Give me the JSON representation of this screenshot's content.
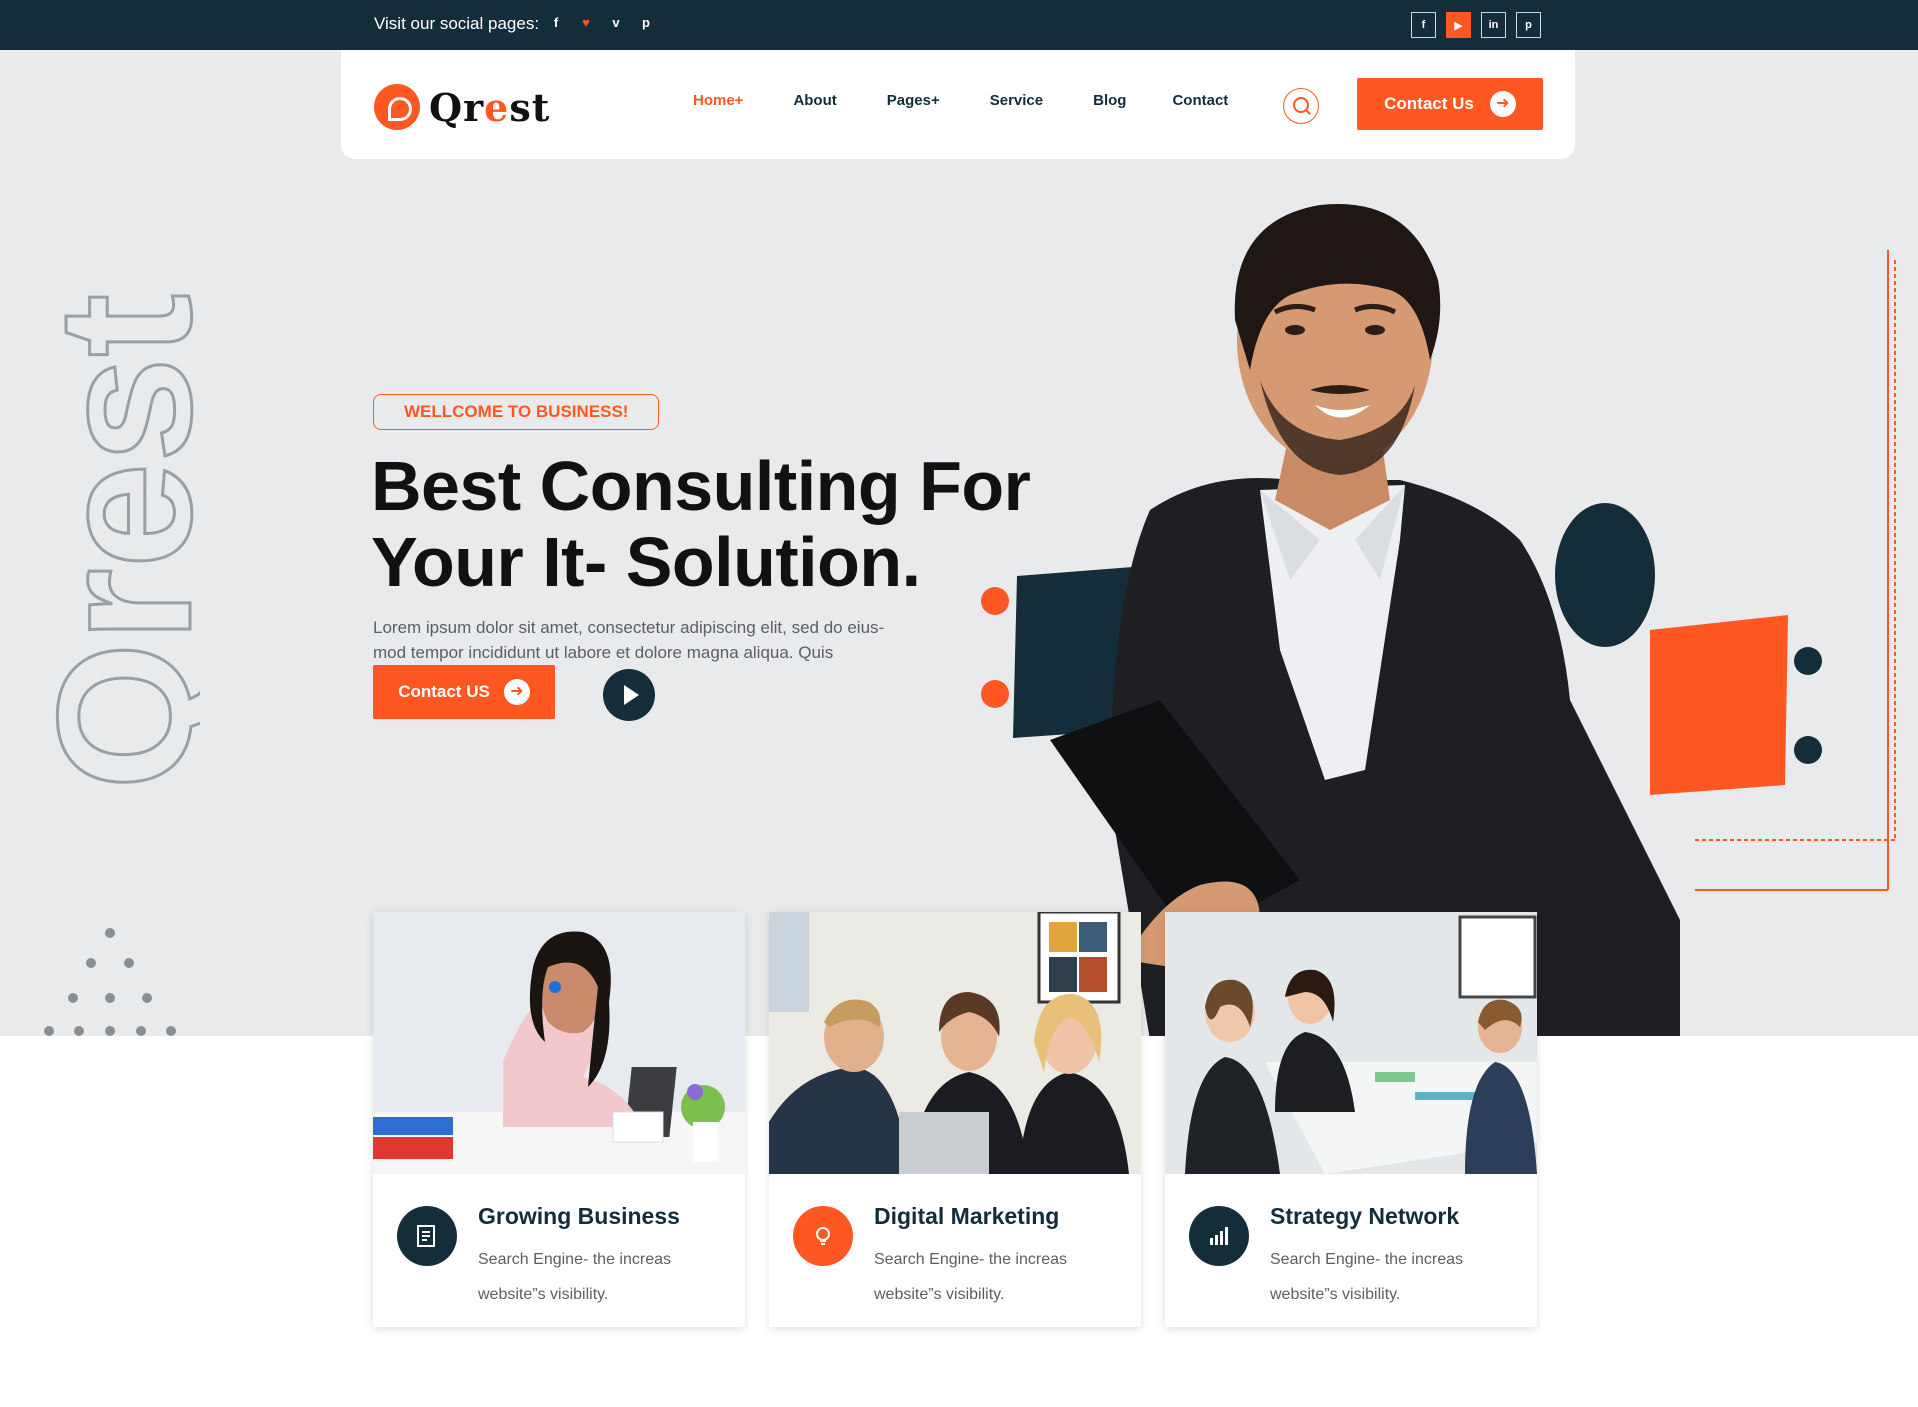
{
  "topbar": {
    "social_label": "Visit our social pages:",
    "left_icons": [
      "facebook-icon",
      "twitter-icon",
      "vimeo-icon",
      "pinterest-icon"
    ],
    "right_icons": [
      "facebook-icon",
      "youtube-icon",
      "linkedin-icon",
      "pinterest-icon"
    ]
  },
  "header": {
    "logo_text_1": "Qr",
    "logo_text_2": "e",
    "logo_text_3": "st",
    "nav": [
      "Home+",
      "About",
      "Pages+",
      "Service",
      "Blog",
      "Contact"
    ],
    "active_nav": "Home+",
    "cta_label": "Contact Us"
  },
  "hero": {
    "watermark": "Qrest",
    "badge": "WELLCOME TO BUSINESS!",
    "title_line1": "Best Consulting For",
    "title_line2": "Your It- Solution.",
    "text": "Lorem ipsum dolor sit amet, consectetur adipiscing elit, sed do eius-mod tempor incididunt ut labore et dolore magna aliqua. Quis",
    "cta_label": "Contact US"
  },
  "cards": [
    {
      "title": "Growing Business",
      "text": "Search   Engine- the increas website”s visibility.",
      "icon": "growth-icon"
    },
    {
      "title": "Digital Marketing",
      "text": "Search   Engine- the increas website”s visibility.",
      "icon": "lightbulb-icon"
    },
    {
      "title": "Strategy Network",
      "text": "Search   Engine- the increas website”s visibility.",
      "icon": "bar-chart-icon"
    }
  ],
  "colors": {
    "accent": "#ff5722",
    "dark": "#142d3a",
    "hero_bg": "#e8eaeb"
  }
}
